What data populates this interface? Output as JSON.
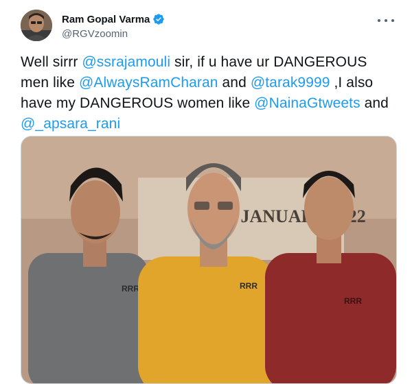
{
  "author": {
    "display_name": "Ram Gopal Varma",
    "handle": "@RGVzoomin",
    "verified": true,
    "verified_color": "#1d9bf0"
  },
  "tweet": {
    "parts": [
      {
        "t": "Well sirrr "
      },
      {
        "t": "@ssrajamouli",
        "m": true
      },
      {
        "t": " sir, if u have ur DANGEROUS men like "
      },
      {
        "t": "@AlwaysRamCharan",
        "m": true
      },
      {
        "t": " and "
      },
      {
        "t": "@tarak9999",
        "m": true
      },
      {
        "t": " ,I also have my DANGEROUS women like "
      },
      {
        "t": "@NainaGtweets",
        "m": true
      },
      {
        "t": " and "
      },
      {
        "t": "@_apsara_rani",
        "m": true
      }
    ]
  },
  "media": {
    "banner_text": "7 JANUARY 2022",
    "badge_text": "RRR"
  },
  "icons": {
    "more": "more-horizontal-icon",
    "verified": "verified-badge-icon"
  },
  "colors": {
    "mention": "#1d9bf0",
    "text": "#0f1419",
    "secondary": "#536471"
  }
}
